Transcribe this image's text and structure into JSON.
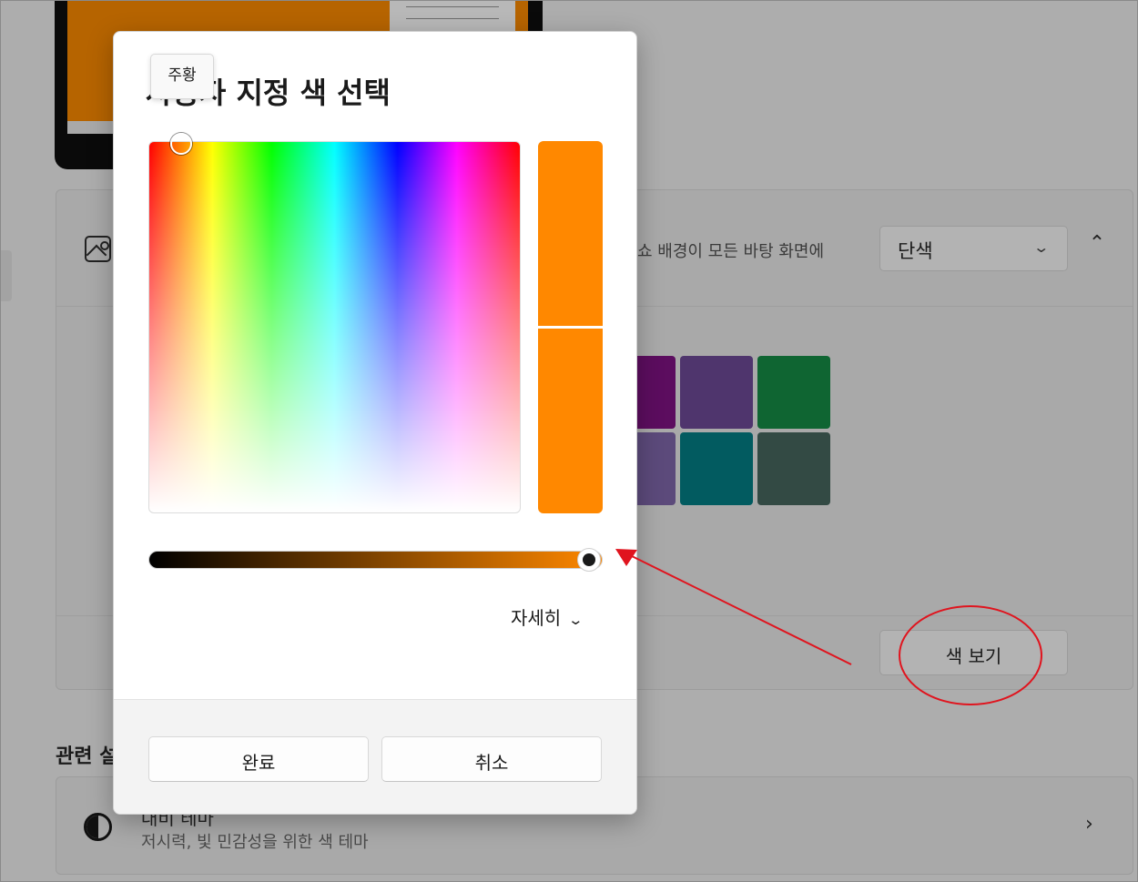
{
  "background": {
    "accent_color": "#b66400",
    "card": {
      "icon": "image-icon",
      "description": "쇼 배경이 모든 바탕 화면에",
      "dropdown_value": "단색",
      "dropdown_icon": "chevron-down-icon",
      "collapse_icon": "chevron-up-icon"
    },
    "swatches": [
      {
        "color": "#5c0d5f"
      },
      {
        "color": "#4f356d"
      },
      {
        "color": "#0f6532"
      },
      {
        "color": "#5c4a7b"
      },
      {
        "color": "#025b60"
      },
      {
        "color": "#334a44"
      }
    ],
    "view_colors_label": "색 보기",
    "related_heading": "관련 설",
    "related_item": {
      "icon": "contrast-icon",
      "title": "대비 테마",
      "subtitle": "저시력, 빛 민감성을 위한 색 테마",
      "chevron_icon": "chevron-right-icon"
    }
  },
  "dialog": {
    "title": "사용자 지정 색 선택",
    "tooltip": "주황",
    "selected_color": "#ff8800",
    "previous_color": "#ff8800",
    "value_slider_level": 0.97,
    "value_gradient_end": "#ff8800",
    "details_label": "자세히",
    "details_icon": "chevron-down-icon",
    "done_label": "완료",
    "cancel_label": "취소"
  },
  "annotation": {
    "color": "#e0141e",
    "type": "arrow-and-circle"
  }
}
